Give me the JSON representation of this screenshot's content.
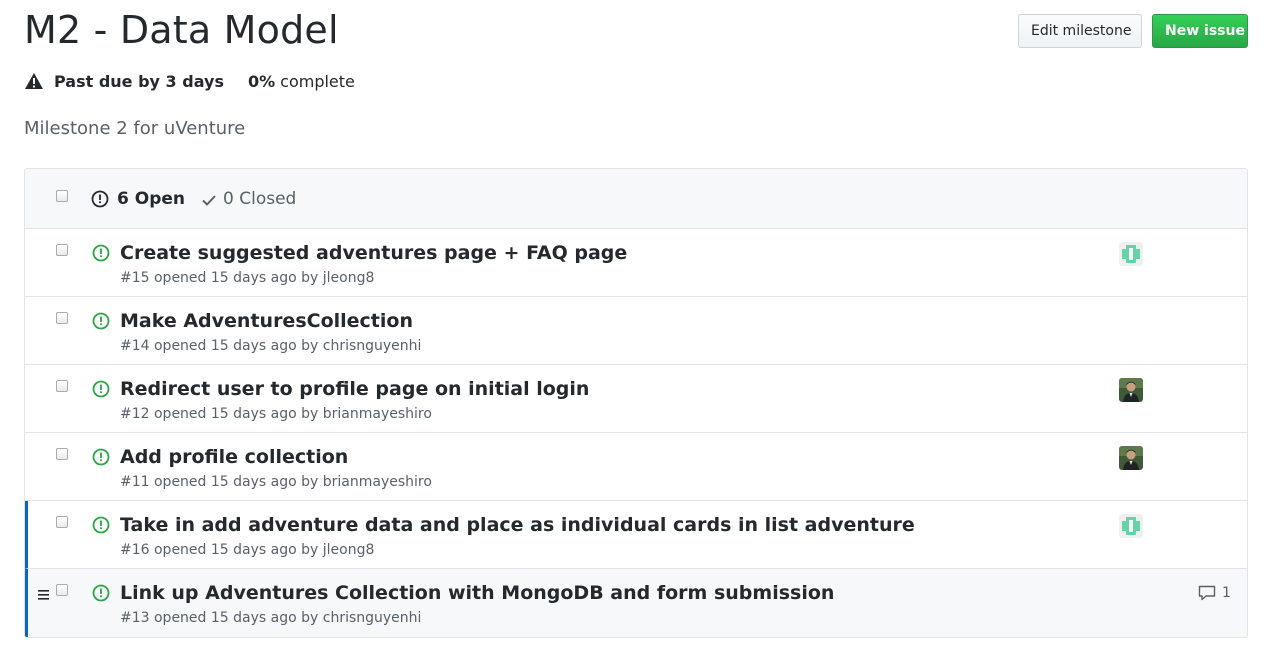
{
  "milestone": {
    "title": "M2 - Data Model",
    "due_status": "Past due by 3 days",
    "percent": "0%",
    "complete_label": "complete",
    "description": "Milestone 2 for uVenture"
  },
  "actions": {
    "edit_label": "Edit milestone",
    "new_label": "New issue"
  },
  "list_header": {
    "open_label": "6 Open",
    "closed_label": "0 Closed"
  },
  "colors": {
    "open_green": "#28a745",
    "active_border": "#0366d6",
    "new_button": "#2cbe4e"
  },
  "issues": [
    {
      "title": "Create suggested adventures page + FAQ page",
      "meta": "#15 opened 15 days ago by jleong8",
      "avatar": "identicon-green"
    },
    {
      "title": "Make AdventuresCollection",
      "meta": "#14 opened 15 days ago by chrisnguyenhi",
      "avatar": ""
    },
    {
      "title": "Redirect user to profile page on initial login",
      "meta": "#12 opened 15 days ago by brianmayeshiro",
      "avatar": "photo-avatar"
    },
    {
      "title": "Add profile collection",
      "meta": "#11 opened 15 days ago by brianmayeshiro",
      "avatar": "photo-avatar"
    },
    {
      "title": "Take in add adventure data and place as individual cards in list adventure",
      "meta": "#16 opened 15 days ago by jleong8",
      "avatar": "identicon-green"
    },
    {
      "title": "Link up Adventures Collection with MongoDB and form submission",
      "meta": "#13 opened 15 days ago by chrisnguyenhi",
      "comment_count": "1"
    }
  ]
}
